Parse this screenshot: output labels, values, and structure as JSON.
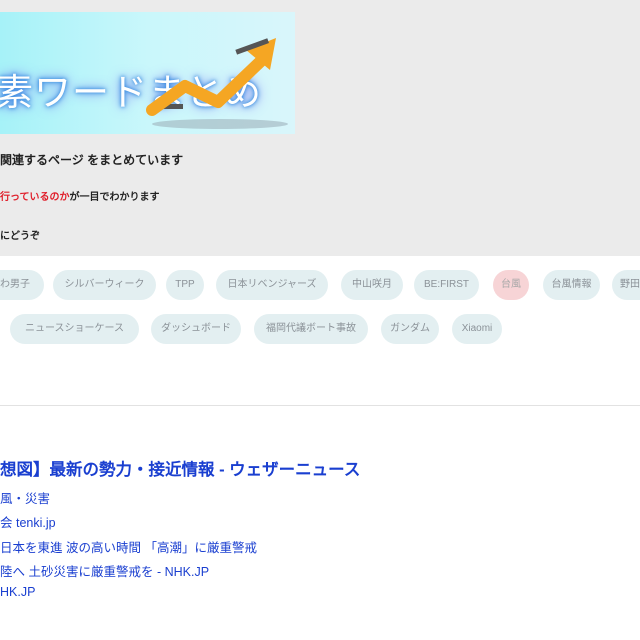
{
  "header": {
    "logo_text": "素ワードまとめ",
    "intro_line1": "関連するページ をまとめています",
    "intro_line2_red": "行っているのか",
    "intro_line2_rest": "が一目でわかります",
    "intro_line3": "にどうぞ"
  },
  "tags_row1": [
    {
      "label": "わ男子",
      "active": false
    },
    {
      "label": "シルバーウィーク",
      "active": false
    },
    {
      "label": "TPP",
      "active": false
    },
    {
      "label": "日本リベンジャーズ",
      "active": false
    },
    {
      "label": "中山咲月",
      "active": false
    },
    {
      "label": "BE:FIRST",
      "active": false
    },
    {
      "label": "台風",
      "active": true
    },
    {
      "label": "台風情報",
      "active": false
    },
    {
      "label": "野田",
      "active": false
    }
  ],
  "tags_row2": [
    {
      "label": "ニュースショーケース",
      "active": false
    },
    {
      "label": "ダッシュボード",
      "active": false
    },
    {
      "label": "福岡代議ボート事故",
      "active": false
    },
    {
      "label": "ガンダム",
      "active": false
    },
    {
      "label": "Xiaomi",
      "active": false
    }
  ],
  "results": {
    "title": "想図】最新の勢力・接近情報 - ウェザーニュース",
    "lines": [
      "風・災害",
      "会 tenki.jp",
      "日本を東進 波の高い時間 「高潮」に厳重警戒",
      "陸へ 土砂災害に厳重警戒を - NHK.JP",
      "HK.JP"
    ]
  },
  "colors": {
    "header_bg": "#ebebeb",
    "tag_bg": "#e3eff1",
    "tag_active_bg": "#f7d4d6",
    "link_blue": "#1a3fd0",
    "accent_red": "#e01e2a"
  }
}
